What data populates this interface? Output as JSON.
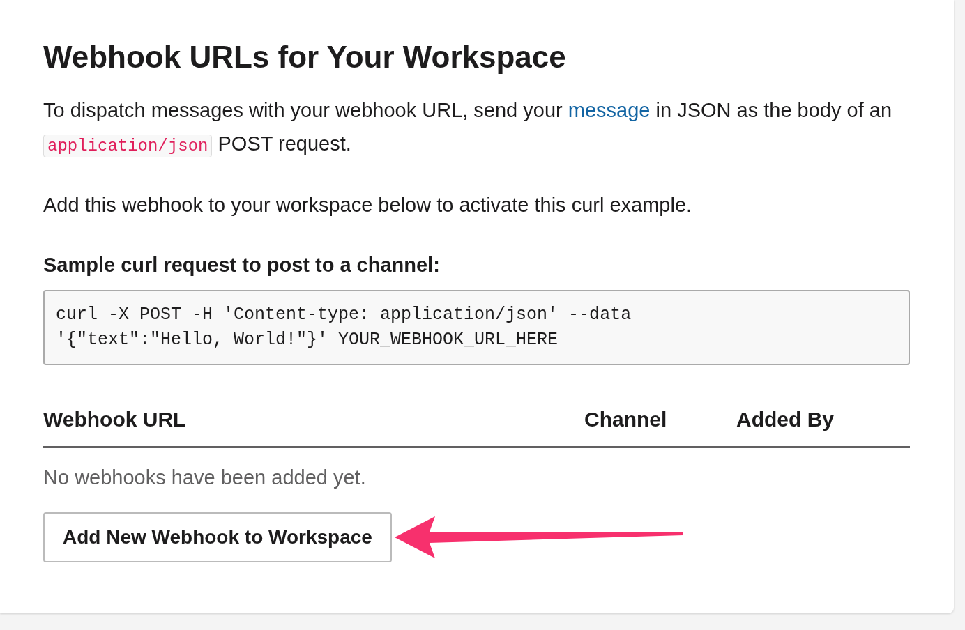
{
  "title": "Webhook URLs for Your Workspace",
  "intro": {
    "before": "To dispatch messages with your webhook URL, send your ",
    "link": "message",
    "middle": " in JSON as the body of an ",
    "code": "application/json",
    "after": " POST request."
  },
  "note": "Add this webhook to your workspace below to activate this curl example.",
  "sample_heading": "Sample curl request to post to a channel:",
  "sample_code": "curl -X POST -H 'Content-type: application/json' --data '{\"text\":\"Hello, World!\"}' YOUR_WEBHOOK_URL_HERE",
  "table": {
    "columns": [
      "Webhook URL",
      "Channel",
      "Added By"
    ],
    "empty_text": "No webhooks have been added yet."
  },
  "button": "Add New Webhook to Workspace"
}
